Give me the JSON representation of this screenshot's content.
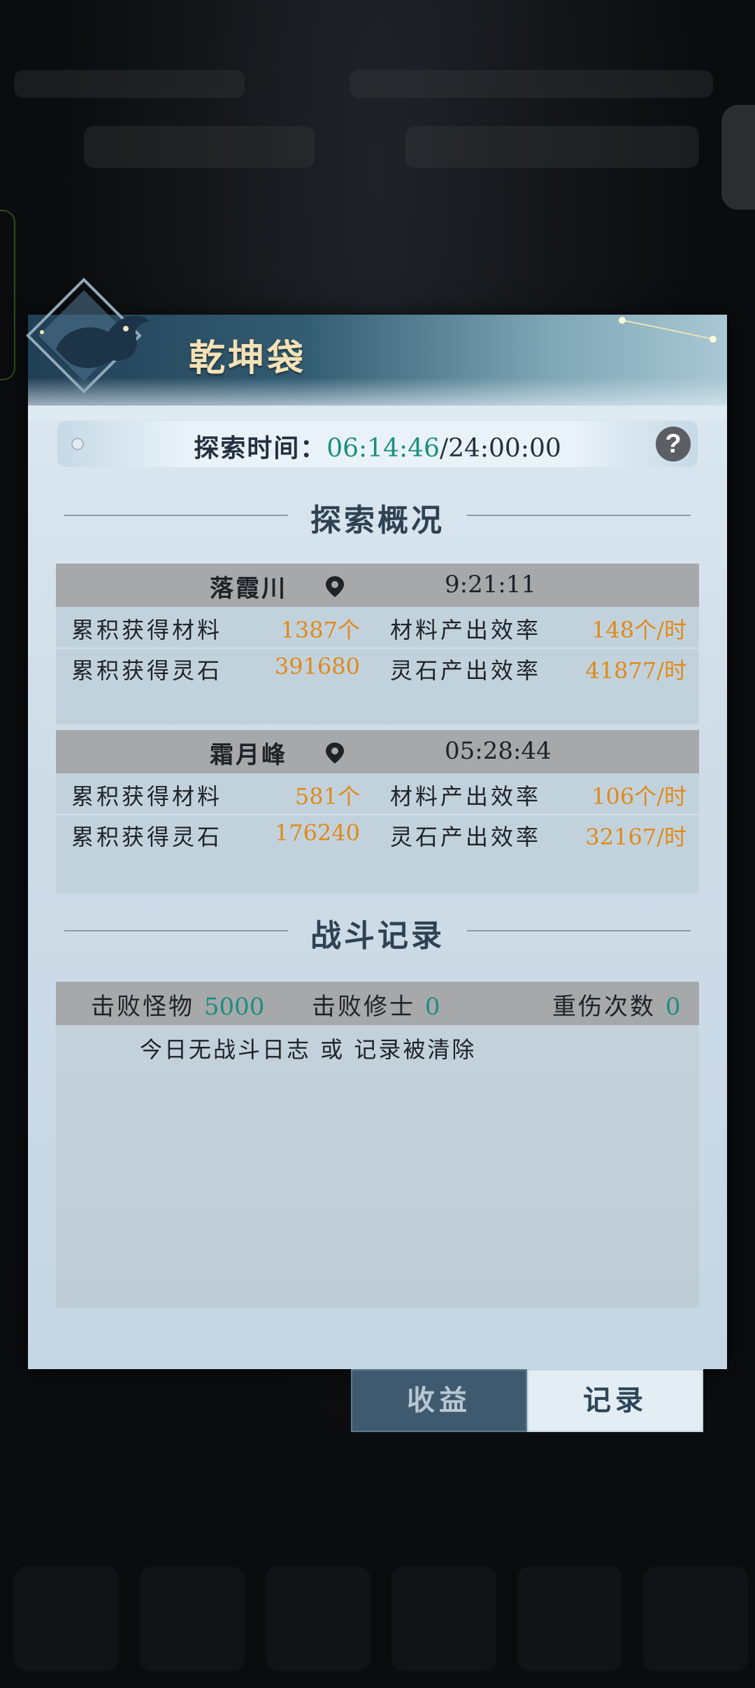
{
  "dialog": {
    "title": "乾坤袋",
    "explore_time": {
      "label": "探索时间：",
      "current": "06:14:46",
      "separator": "/",
      "total": "24:00:00"
    },
    "help_icon": "?",
    "overview_heading": "探索概况",
    "locations": [
      {
        "name": "落霞川",
        "time": "9:21:11",
        "rows": [
          {
            "label": "累积获得材料",
            "value": "1387个",
            "rate_label": "材料产出效率",
            "rate": "148个/时"
          },
          {
            "label": "累积获得灵石",
            "value": "391680",
            "rate_label": "灵石产出效率",
            "rate": "41877/时"
          }
        ]
      },
      {
        "name": "霜月峰",
        "time": "05:28:44",
        "rows": [
          {
            "label": "累积获得材料",
            "value": "581个",
            "rate_label": "材料产出效率",
            "rate": "106个/时"
          },
          {
            "label": "累积获得灵石",
            "value": "176240",
            "rate_label": "灵石产出效率",
            "rate": "32167/时"
          }
        ]
      }
    ],
    "battle_heading": "战斗记录",
    "battle": {
      "monsters_label": "击败怪物",
      "monsters_value": "5000",
      "cultivators_label": "击败修士",
      "cultivators_value": "0",
      "injury_label": "重伤次数",
      "injury_value": "0",
      "empty_text": "今日无战斗日志 或 记录被清除"
    }
  },
  "tabs": {
    "income": "收益",
    "record": "记录"
  },
  "colors": {
    "accent_teal": "#1b8e80",
    "value_orange": "#e08a18",
    "title_gold": "#f4e2b6"
  }
}
